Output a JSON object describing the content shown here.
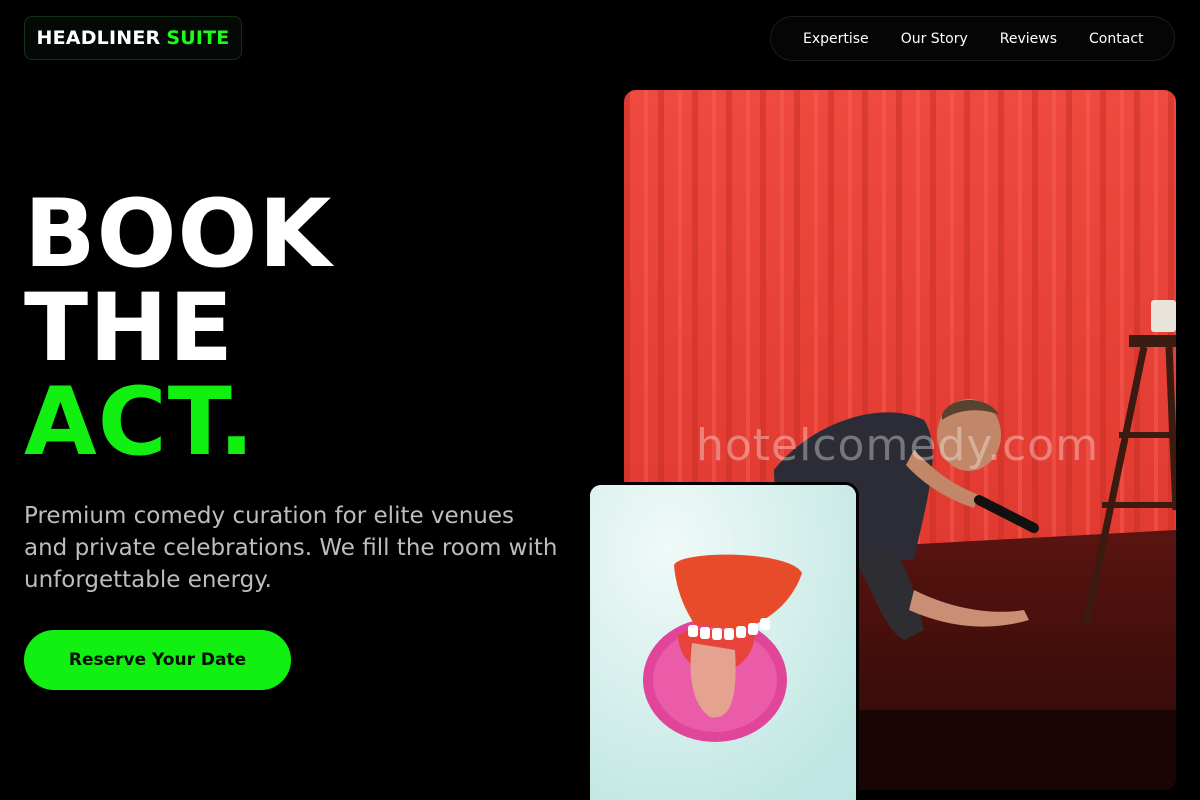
{
  "brand": {
    "name_main": "HEADLINER",
    "name_accent": "SUITE",
    "accent_color": "#12f012"
  },
  "nav": {
    "items": [
      {
        "label": "Expertise"
      },
      {
        "label": "Our Story"
      },
      {
        "label": "Reviews"
      },
      {
        "label": "Contact"
      }
    ]
  },
  "hero": {
    "title_line1": "BOOK",
    "title_line2": "THE",
    "title_line3": "ACT.",
    "subtitle": "Premium comedy curation for elite venues and private celebrations. We fill the room with unforgettable energy.",
    "cta_label": "Reserve Your Date"
  },
  "photos": {
    "main_watermark": "hotelcomedy.com",
    "main_subject": "comedian-on-stage-red-curtain",
    "secondary_subject": "wind-up-chattering-teeth-toy"
  },
  "colors": {
    "background": "#000000",
    "accent": "#12f012",
    "subtitle_text": "#bdbdbd",
    "curtain_red": "#e8453c"
  }
}
